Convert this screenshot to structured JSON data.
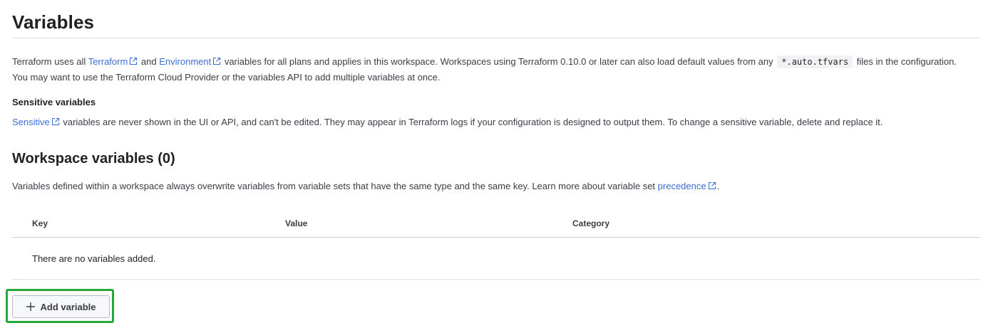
{
  "page": {
    "title": "Variables"
  },
  "intro": {
    "text_1": "Terraform uses all ",
    "link_terraform": "Terraform",
    "text_2": " and ",
    "link_environment": "Environment",
    "text_3": " variables for all plans and applies in this workspace. Workspaces using Terraform 0.10.0 or later can also load default values from any ",
    "code": "*.auto.tfvars",
    "text_4": " files in the configuration. You may want to use the Terraform Cloud Provider or the variables API to add multiple variables at once."
  },
  "sensitive": {
    "heading": "Sensitive variables",
    "link": "Sensitive",
    "text": " variables are never shown in the UI or API, and can't be edited. They may appear in Terraform logs if your configuration is designed to output them. To change a sensitive variable, delete and replace it."
  },
  "workspace_variables": {
    "title": "Workspace variables (0)",
    "text_1": "Variables defined within a workspace always overwrite variables from variable sets that have the same type and the same key. Learn more about variable set ",
    "link": "precedence",
    "text_2": "."
  },
  "table": {
    "columns": [
      "Key",
      "Value",
      "Category"
    ],
    "empty_message": "There are no variables added."
  },
  "actions": {
    "add_variable_label": "Add variable"
  },
  "colors": {
    "link": "#3b6fd6",
    "highlight": "#23a83a"
  },
  "icons": {
    "external_link": "external-link-icon",
    "add": "plus-icon"
  }
}
